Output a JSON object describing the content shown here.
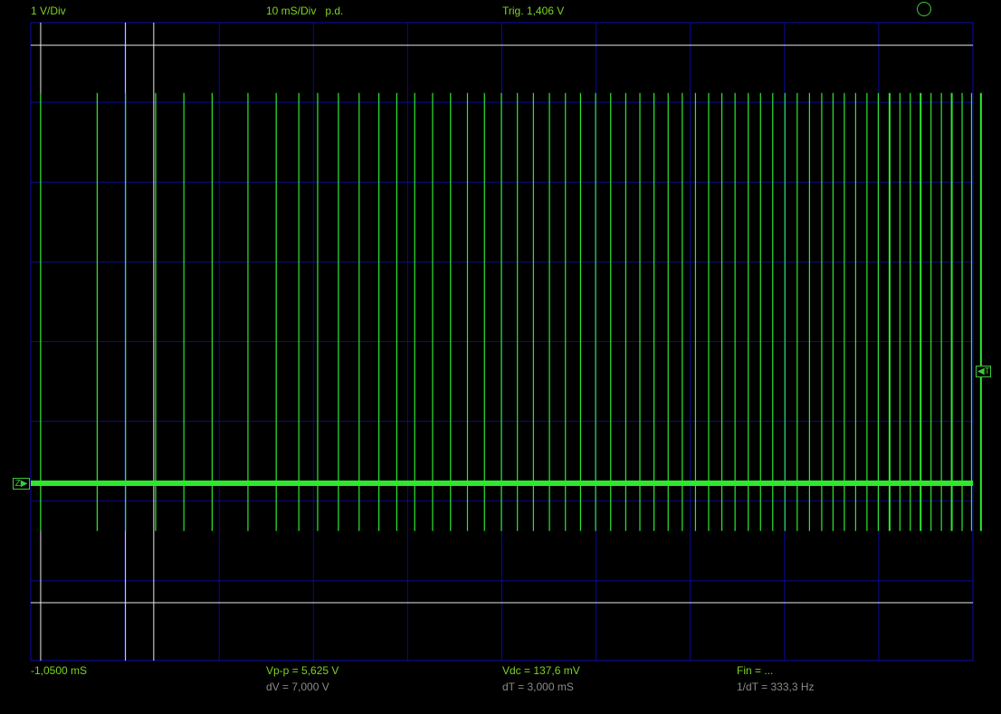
{
  "header": {
    "volts_per_div": "1 V/Div",
    "time_per_div": "10 mS/Div   p.d.",
    "trigger": "Trig. 1,406 V",
    "status_icon": "circle-icon"
  },
  "markers": {
    "trigger_marker": "T",
    "ground_marker": "Z"
  },
  "readouts": {
    "time_offset": "-1,0500 mS",
    "vpp": "Vp-p = 5,625 V",
    "dv": "dV = 7,000 V",
    "vdc": "Vdc = 137,6 mV",
    "dt": "dT = 3,000 mS",
    "fin": "Fin = ...",
    "inv_dt": "1/dT = 333,3 Hz"
  },
  "colors": {
    "background": "#000000",
    "grid": "#0a0a96",
    "trace": "#2ee82e",
    "cursor": "#e8e8e8",
    "label_green": "#7dd320",
    "label_gray": "#8a8a8a"
  },
  "scope_data": {
    "cursors_time_ms": [
      0,
      9.0,
      12.0
    ],
    "cursors_volts": [
      5.5,
      -1.5
    ],
    "baseline_volts": 0.0,
    "pulse_high_volts": 4.9,
    "pulse_low_volts": -0.6,
    "pulse_times_ms": [
      0,
      6.0,
      9.0,
      12.2,
      15.2,
      18.2,
      22.0,
      25.0,
      27.4,
      29.4,
      31.6,
      33.8,
      35.9,
      37.8,
      39.7,
      41.6,
      43.5,
      45.3,
      47.1,
      48.9,
      50.6,
      52.3,
      54.0,
      55.7,
      57.3,
      58.9,
      60.5,
      62.1,
      63.6,
      65.1,
      66.6,
      68.1,
      69.5,
      70.9,
      72.3,
      73.7,
      75.1,
      76.4,
      77.7,
      79.0,
      80.3,
      81.6,
      82.9,
      84.1,
      85.3,
      86.5,
      87.7,
      88.9,
      90.1,
      91.2,
      92.3,
      93.4,
      94.5,
      95.6,
      96.7,
      97.8,
      98.8,
      99.8
    ]
  }
}
